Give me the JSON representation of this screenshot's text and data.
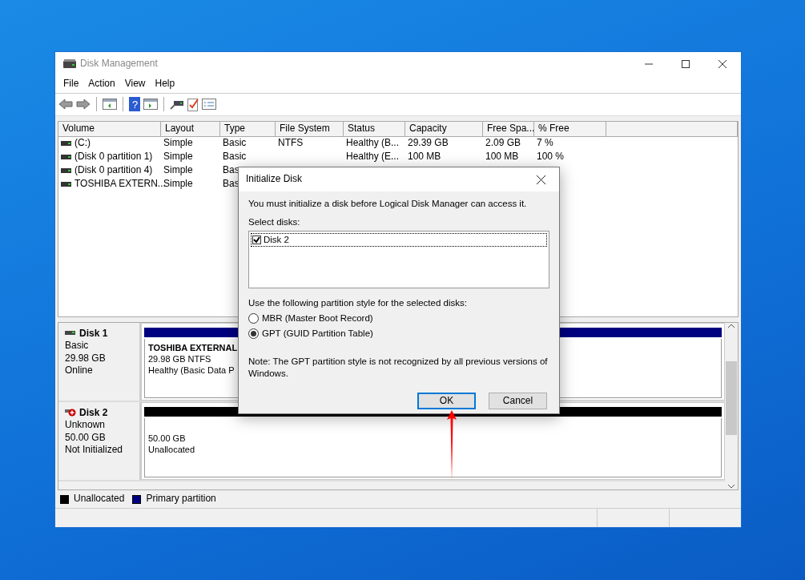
{
  "window": {
    "title": "Disk Management"
  },
  "menu": [
    "File",
    "Action",
    "View",
    "Help"
  ],
  "toolbar": {
    "help_glyph": "?"
  },
  "volume_table": {
    "columns": [
      "Volume",
      "Layout",
      "Type",
      "File System",
      "Status",
      "Capacity",
      "Free Spa...",
      "% Free"
    ],
    "rows": [
      [
        "(C:)",
        "Simple",
        "Basic",
        "NTFS",
        "Healthy (B...",
        "29.39 GB",
        "2.09 GB",
        "7 %"
      ],
      [
        "(Disk 0 partition 1)",
        "Simple",
        "Basic",
        "",
        "Healthy (E...",
        "100 MB",
        "100 MB",
        "100 %"
      ],
      [
        "(Disk 0 partition 4)",
        "Simple",
        "Bas",
        "",
        "",
        "",
        "",
        ""
      ],
      [
        "TOSHIBA EXTERN...",
        "Simple",
        "Bas",
        "",
        "",
        "",
        "",
        ""
      ]
    ]
  },
  "disks": [
    {
      "name": "Disk 1",
      "type": "Basic",
      "size": "29.98 GB",
      "status": "Online",
      "initialized": true,
      "color": "#000080",
      "partition": {
        "name": "TOSHIBA EXTERNAL",
        "size": "29.98 GB NTFS",
        "status": "Healthy (Basic Data P"
      }
    },
    {
      "name": "Disk 2",
      "type": "Unknown",
      "size": "50.00 GB",
      "status": "Not Initialized",
      "initialized": false,
      "color": "#000000",
      "partition": {
        "size": "50.00 GB",
        "status": "Unallocated"
      }
    }
  ],
  "legend": [
    {
      "label": "Unallocated",
      "color": "#000000"
    },
    {
      "label": "Primary partition",
      "color": "#000080"
    }
  ],
  "dialog": {
    "title": "Initialize Disk",
    "message": "You must initialize a disk before Logical Disk Manager can access it.",
    "select_label": "Select disks:",
    "disks": [
      {
        "label": "Disk 2",
        "checked": true
      }
    ],
    "style_label": "Use the following partition style for the selected disks:",
    "options": [
      {
        "label": "MBR (Master Boot Record)",
        "selected": false
      },
      {
        "label": "GPT (GUID Partition Table)",
        "selected": true
      }
    ],
    "note": "Note: The GPT partition style is not recognized by all previous versions of Windows.",
    "buttons": [
      {
        "label": "OK",
        "default": true
      },
      {
        "label": "Cancel",
        "default": false
      }
    ]
  }
}
